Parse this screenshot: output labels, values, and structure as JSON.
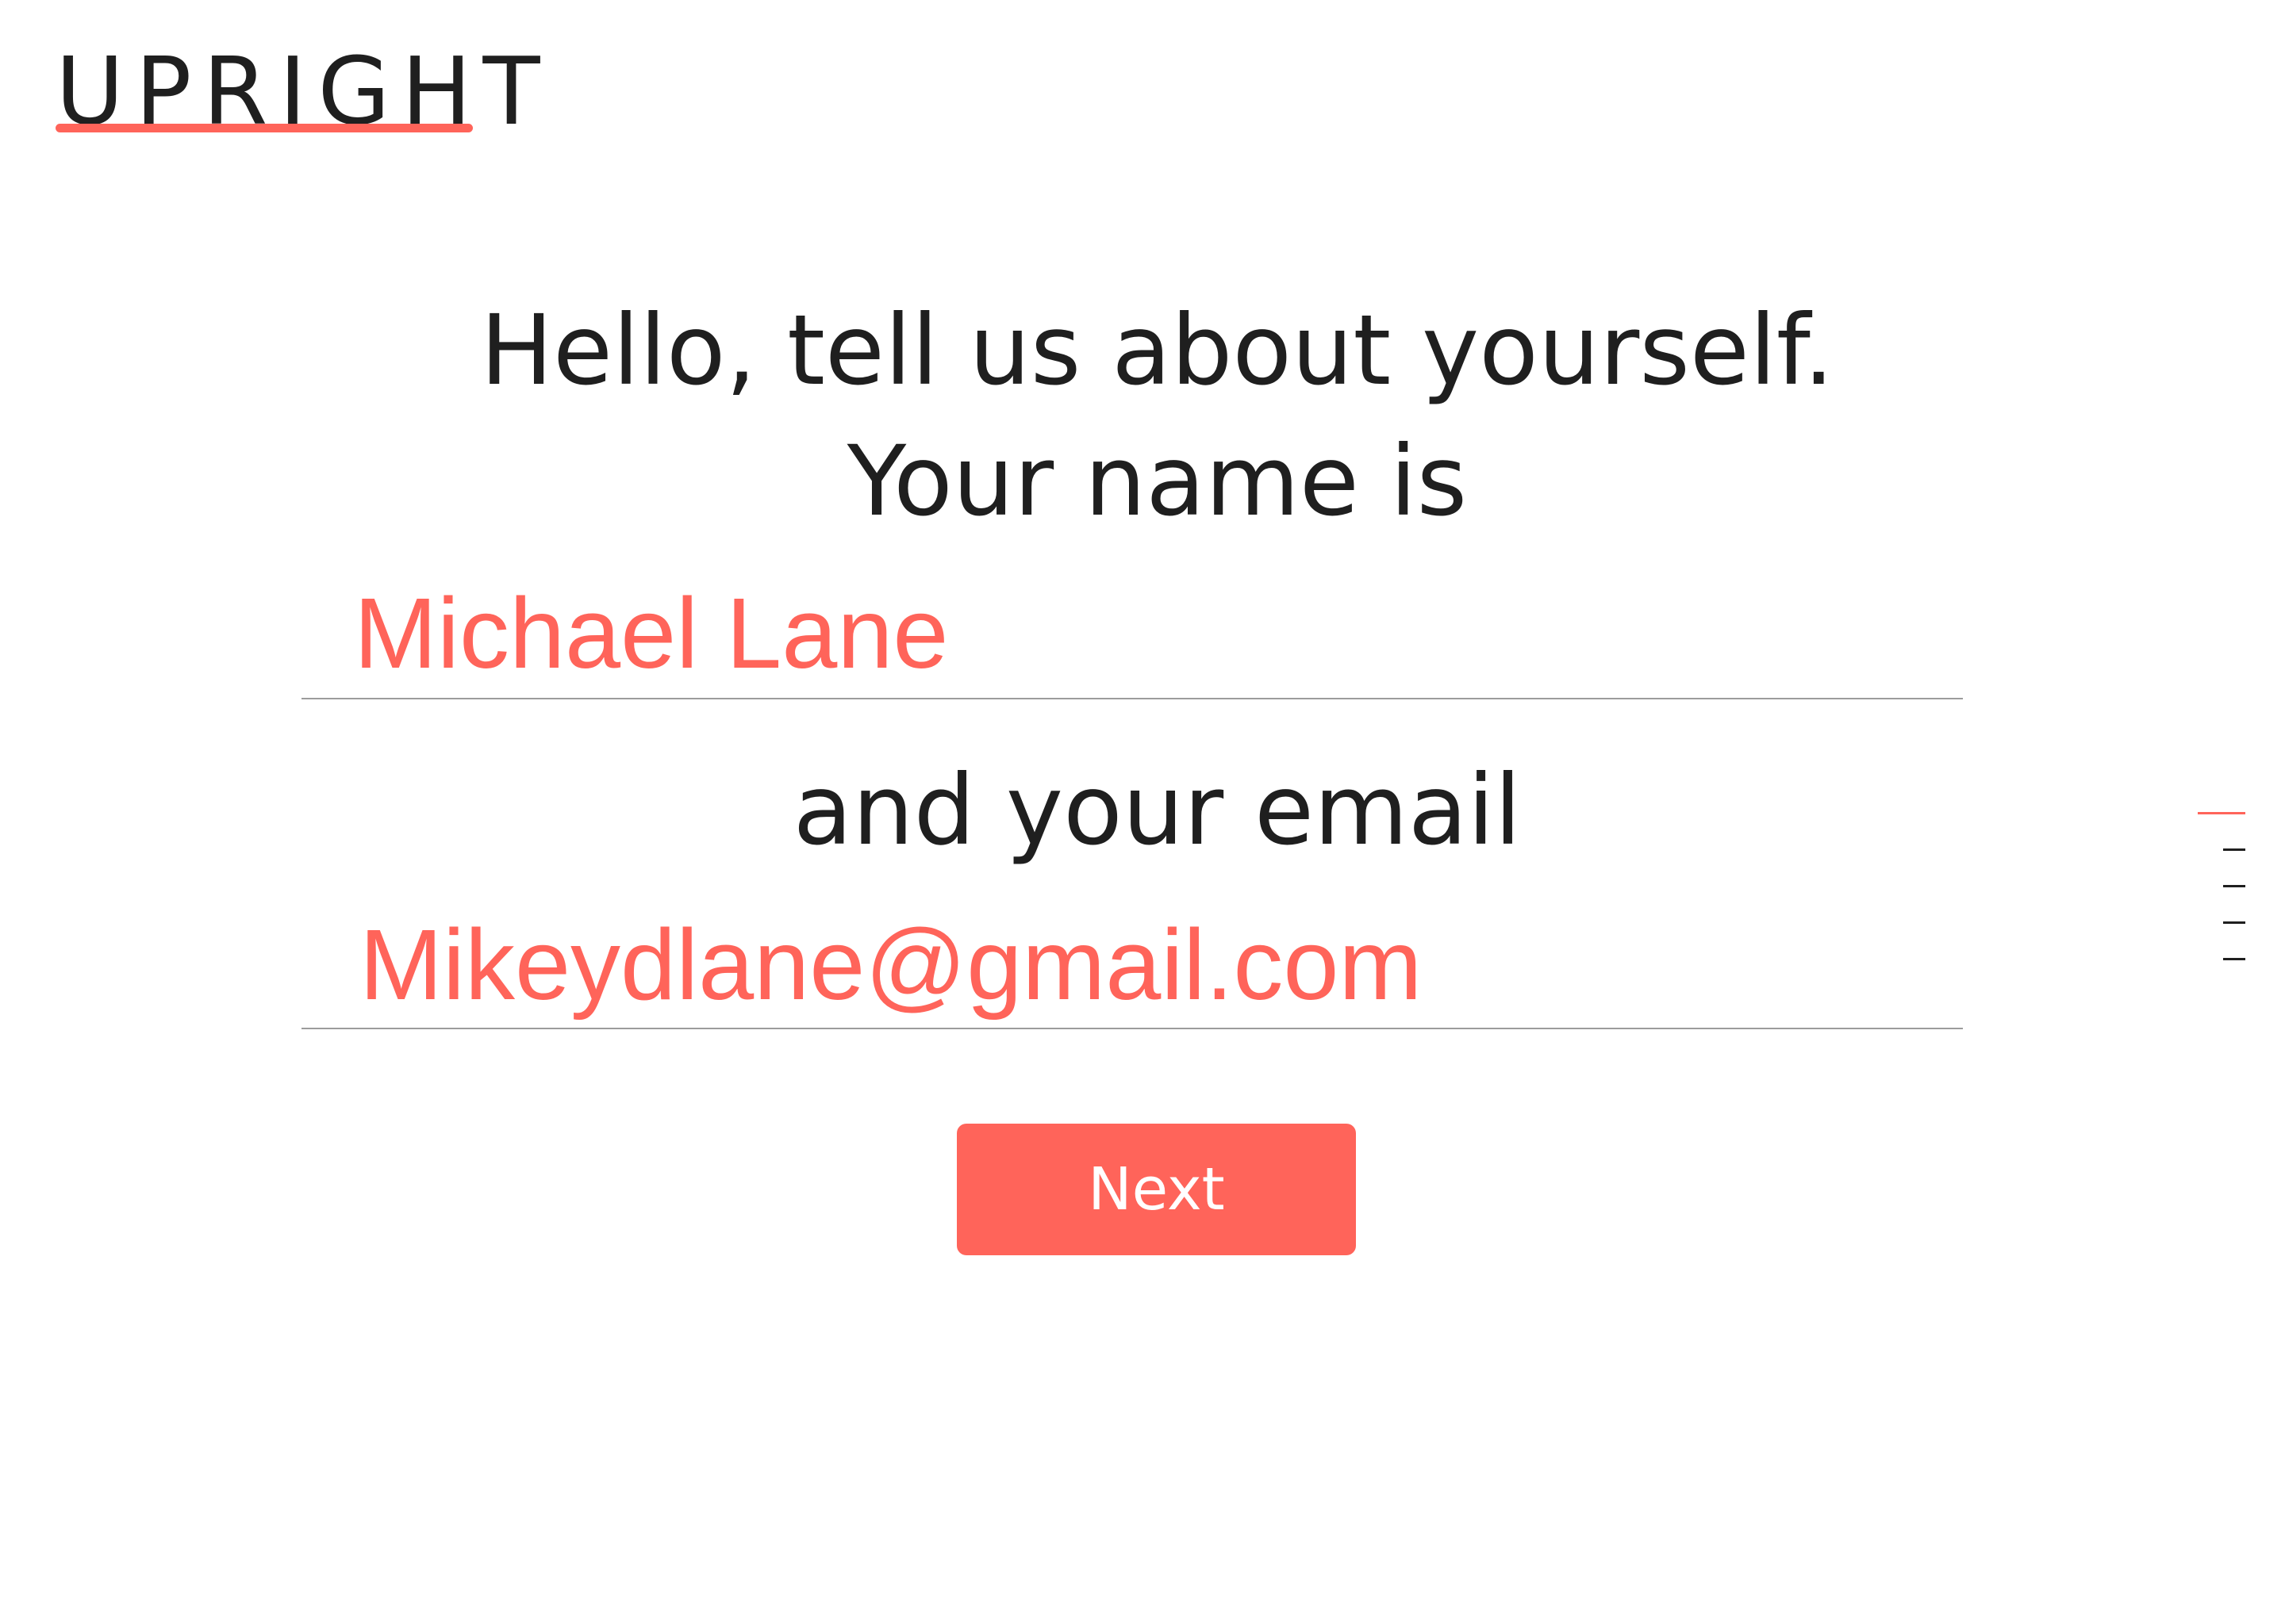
{
  "app": {
    "logo_text": "UPRIGHT"
  },
  "colors": {
    "accent": "#ff645a",
    "text": "#1f1f1f",
    "rule": "#9c9c9c",
    "button_text": "#ffffff"
  },
  "form": {
    "headline_line1": "Hello, tell us about yourself.",
    "headline_line2": "Your name is",
    "name_value": "Michael Lane",
    "email_prompt": "and your email",
    "email_value": "Mikeydlane@gmail.com",
    "next_label": "Next"
  },
  "progress": {
    "total_steps": 5,
    "current_step": 1
  }
}
